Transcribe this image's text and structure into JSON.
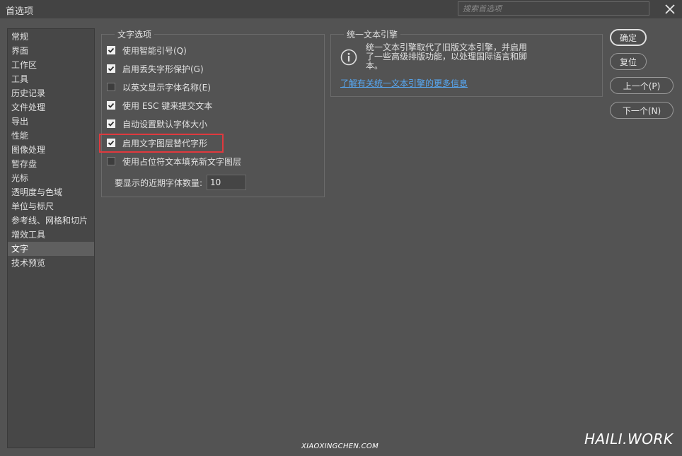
{
  "window": {
    "title": "首选项",
    "search_placeholder": "搜索首选项",
    "close_icon": "close-icon"
  },
  "sidebar": {
    "items": [
      {
        "label": "常规"
      },
      {
        "label": "界面"
      },
      {
        "label": "工作区"
      },
      {
        "label": "工具"
      },
      {
        "label": "历史记录"
      },
      {
        "label": "文件处理"
      },
      {
        "label": "导出"
      },
      {
        "label": "性能"
      },
      {
        "label": "图像处理"
      },
      {
        "label": "暂存盘"
      },
      {
        "label": "光标"
      },
      {
        "label": "透明度与色域"
      },
      {
        "label": "单位与标尺"
      },
      {
        "label": "参考线、网格和切片"
      },
      {
        "label": "增效工具"
      },
      {
        "label": "文字",
        "selected": true
      },
      {
        "label": "技术预览"
      }
    ]
  },
  "type_options": {
    "legend": "文字选项",
    "options": [
      {
        "label": "使用智能引号(Q)",
        "checked": true
      },
      {
        "label": "启用丢失字形保护(G)",
        "checked": true
      },
      {
        "label": "以英文显示字体名称(E)",
        "checked": false
      },
      {
        "label": "使用 ESC 键来提交文本",
        "checked": true
      },
      {
        "label": "自动设置默认字体大小",
        "checked": true
      },
      {
        "label": "启用文字图层替代字形",
        "checked": true,
        "highlighted": true
      },
      {
        "label": "使用占位符文本填充新文字图层",
        "checked": false
      }
    ],
    "recent_fonts_label": "要显示的近期字体数量:",
    "recent_fonts_value": "10"
  },
  "text_engine": {
    "legend": "统一文本引擎",
    "icon": "info-icon",
    "description_lines": [
      "统一文本引擎取代了旧版文本引擎，并启用",
      "了一些高级排版功能，以处理国际语言和脚",
      "本。"
    ],
    "link": "了解有关统一文本引擎的更多信息"
  },
  "buttons": {
    "ok": "确定",
    "reset": "复位",
    "prev": "上一个(P)",
    "next": "下一个(N)"
  },
  "watermarks": {
    "small": "XIAOXINGCHEN.COM",
    "large": "HAILI.WORK"
  },
  "colors": {
    "background": "#535353",
    "titlebar": "#434343",
    "link": "#57a9f5",
    "highlight_border": "#e0393e",
    "selected_item": "#5f5f5f"
  }
}
